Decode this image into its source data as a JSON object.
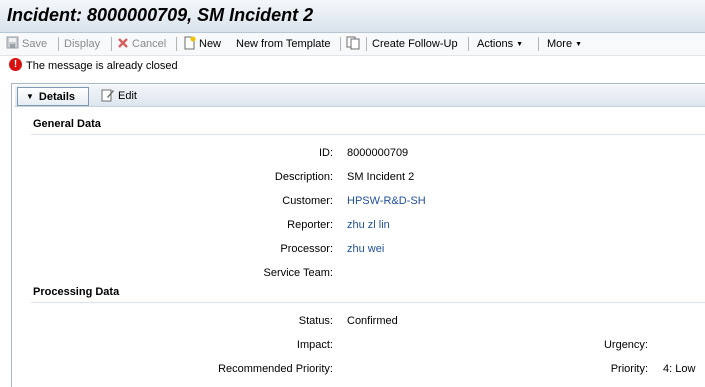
{
  "window": {
    "title": "Incident: 8000000709, SM Incident 2"
  },
  "toolbar": {
    "save": "Save",
    "display": "Display",
    "cancel": "Cancel",
    "new": "New",
    "new_from_template": "New from Template",
    "create_follow_up": "Create Follow-Up",
    "actions": "Actions",
    "more": "More"
  },
  "message": {
    "text": "The message is already closed",
    "type": "error"
  },
  "details": {
    "tab_label": "Details",
    "edit_label": "Edit"
  },
  "general_data": {
    "title": "General Data",
    "fields": {
      "id_label": "ID:",
      "id_value": "8000000709",
      "description_label": "Description:",
      "description_value": "SM Incident 2",
      "customer_label": "Customer:",
      "customer_value": "HPSW-R&D-SH",
      "reporter_label": "Reporter:",
      "reporter_value": "zhu zl lin",
      "processor_label": "Processor:",
      "processor_value": "zhu wei",
      "service_team_label": "Service Team:",
      "service_team_value": ""
    }
  },
  "processing_data": {
    "title": "Processing Data",
    "fields": {
      "status_label": "Status:",
      "status_value": "Confirmed",
      "impact_label": "Impact:",
      "impact_value": "",
      "urgency_label": "Urgency:",
      "urgency_value": "",
      "recommended_priority_label": "Recommended Priority:",
      "recommended_priority_value": "",
      "priority_label": "Priority:",
      "priority_value": "4: Low"
    }
  },
  "colors": {
    "link": "#1f4f9c",
    "error": "#d91010",
    "header_bg": "#dde6ee"
  }
}
